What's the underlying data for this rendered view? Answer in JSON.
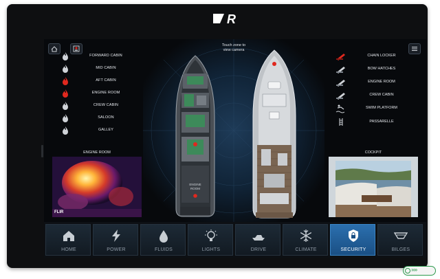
{
  "header": {
    "logo_text": "R"
  },
  "top_controls": {
    "home_icon": "home-icon",
    "fire_panel_icon": "fire-panel-icon",
    "menu_icon": "menu-icon"
  },
  "fire_zones": [
    {
      "label": "FORWARD CABIN",
      "status": "clear",
      "color": "#cfd3d8"
    },
    {
      "label": "MID CABIN",
      "status": "clear",
      "color": "#cfd3d8"
    },
    {
      "label": "AFT CABIN",
      "status": "alarm",
      "color": "#e0281e"
    },
    {
      "label": "ENGINE ROOM",
      "status": "alarm",
      "color": "#e0281e"
    },
    {
      "label": "CREW CABIN",
      "status": "clear",
      "color": "#cfd3d8"
    },
    {
      "label": "SALOON",
      "status": "clear",
      "color": "#cfd3d8"
    },
    {
      "label": "GALLEY",
      "status": "clear",
      "color": "#cfd3d8"
    }
  ],
  "hatches": [
    {
      "label": "CHAIN LOCKER",
      "status": "open",
      "color": "#e0281e"
    },
    {
      "label": "BOW HATCHES",
      "status": "closed",
      "color": "#cfd3d8"
    },
    {
      "label": "ENGINE ROOM",
      "status": "closed",
      "color": "#cfd3d8"
    },
    {
      "label": "CREW CABIN",
      "status": "closed",
      "color": "#cfd3d8"
    },
    {
      "label": "SWIM PLATFORM",
      "status": "closed",
      "color": "#cfd3d8"
    },
    {
      "label": "PASSARELLE",
      "status": "closed",
      "color": "#cfd3d8"
    }
  ],
  "center": {
    "touch_hint_line1": "Touch zone to",
    "touch_hint_line2": "view camera",
    "engine_room_line1": "ENGINE",
    "engine_room_line2": "ROOM"
  },
  "cameras": {
    "left_label": "ENGINE ROOM",
    "left_brand": "FLIR",
    "right_label": "COCKPIT"
  },
  "nav": [
    {
      "label": "HOME",
      "icon": "home-icon",
      "active": false
    },
    {
      "label": "POWER",
      "icon": "lightning-icon",
      "active": false
    },
    {
      "label": "FLUIDS",
      "icon": "droplet-icon",
      "active": false
    },
    {
      "label": "LIGHTS",
      "icon": "bulb-icon",
      "active": false
    },
    {
      "label": "DRIVE",
      "icon": "boat-icon",
      "active": false
    },
    {
      "label": "CLIMATE",
      "icon": "snowflake-icon",
      "active": false
    },
    {
      "label": "SECURITY",
      "icon": "lock-icon",
      "active": true
    },
    {
      "label": "BILGES",
      "icon": "bilge-icon",
      "active": false
    }
  ],
  "colors": {
    "accent": "#2b6fae",
    "alarm": "#e0281e",
    "swipe": "#2b9a4c"
  }
}
